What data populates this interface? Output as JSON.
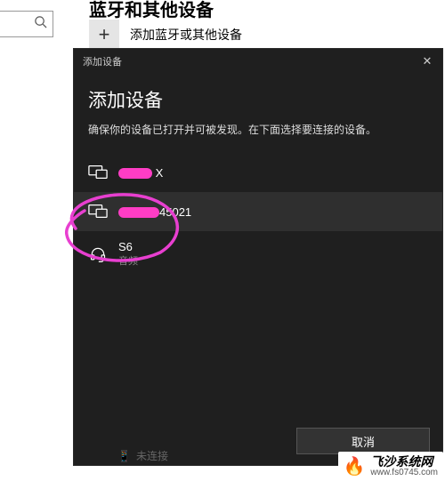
{
  "bg": {
    "truncated_title": "蓝牙和其他设备",
    "add_button_label": "添加蓝牙或其他设备",
    "status_text": "未连接"
  },
  "dialog": {
    "titlebar": "添加设备",
    "heading": "添加设备",
    "subtext": "确保你的设备已打开并可被发现。在下面选择要连接的设备。",
    "devices": [
      {
        "name_suffix": "X",
        "sub": ""
      },
      {
        "name_suffix": "45021",
        "sub": ""
      },
      {
        "name": "S6",
        "sub": "音频"
      }
    ],
    "cancel": "取消"
  },
  "watermark": {
    "logo_emoji": "🔥",
    "title": "飞沙系统网",
    "url": "www.fs0745.com"
  }
}
